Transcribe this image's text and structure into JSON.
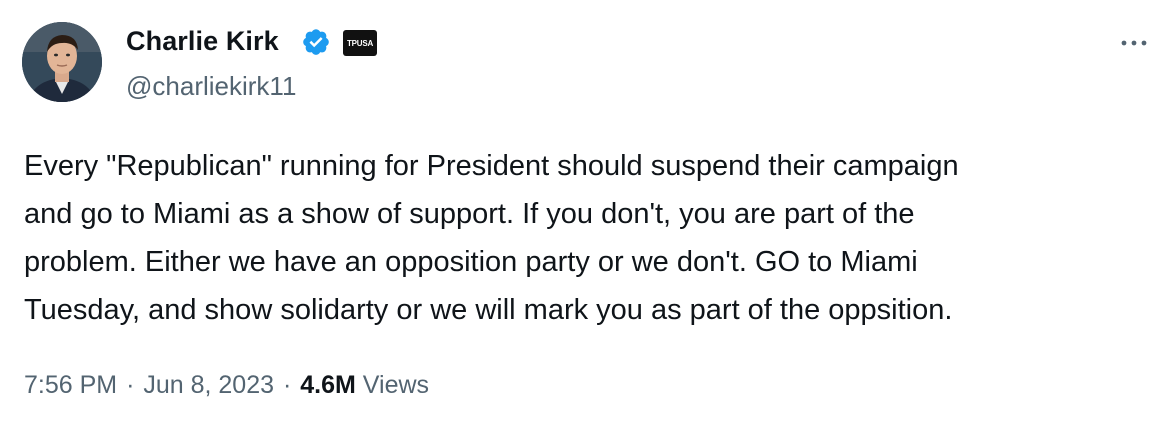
{
  "author": {
    "display_name": "Charlie Kirk",
    "handle": "@charliekirk11",
    "verified": true,
    "affiliate_badge": "TPUSA"
  },
  "tweet": {
    "text": "Every \"Republican\" running for President should suspend their campaign\nand go to Miami as a show of support. If you don't, you are part of the\nproblem. Either we have an opposition party or we don't. GO to Miami\nTuesday, and show solidarty or we will mark you as part of the oppsition.",
    "time": "7:56 PM",
    "date": "Jun 8, 2023",
    "separator": "·",
    "views_count": "4.6M",
    "views_label": "Views"
  },
  "icons": {
    "more": "more-icon",
    "verified": "verified-badge-icon"
  },
  "colors": {
    "text_primary": "#0f1419",
    "text_secondary": "#536471",
    "verified_blue": "#1d9bf0",
    "background": "#ffffff"
  }
}
